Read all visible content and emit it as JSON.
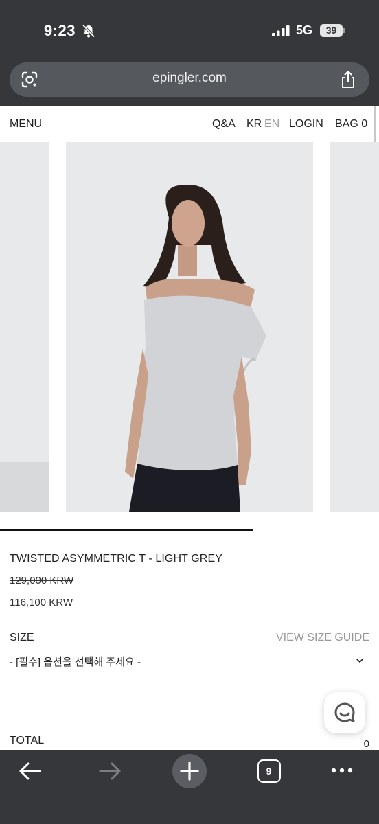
{
  "status_bar": {
    "time": "9:23",
    "network": "5G",
    "battery": "39"
  },
  "browser": {
    "url": "epingler.com",
    "tab_count": "9"
  },
  "header": {
    "menu": "MENU",
    "qa": "Q&A",
    "lang_kr": "KR",
    "lang_en": "EN",
    "login": "LOGIN",
    "bag": "BAG 0"
  },
  "gallery": {
    "progress": 0.667
  },
  "product": {
    "title": "TWISTED ASYMMETRIC T - LIGHT GREY",
    "price_original": "129,000 KRW",
    "price_sale": "116,100 KRW",
    "size_label": "SIZE",
    "size_guide": "VIEW SIZE GUIDE",
    "size_placeholder": "- [필수] 옵션을 선택해 주세요 -",
    "total_label": "TOTAL",
    "total_value": "0"
  },
  "icons": {
    "silent": "bell-slash-icon",
    "signal": "signal-icon",
    "lens": "lens-icon",
    "share": "share-icon",
    "chevron": "chevron-down-icon",
    "chat": "chat-icon",
    "back": "arrow-left-icon",
    "forward": "arrow-right-icon",
    "new_tab": "plus-icon",
    "more": "more-icon"
  }
}
